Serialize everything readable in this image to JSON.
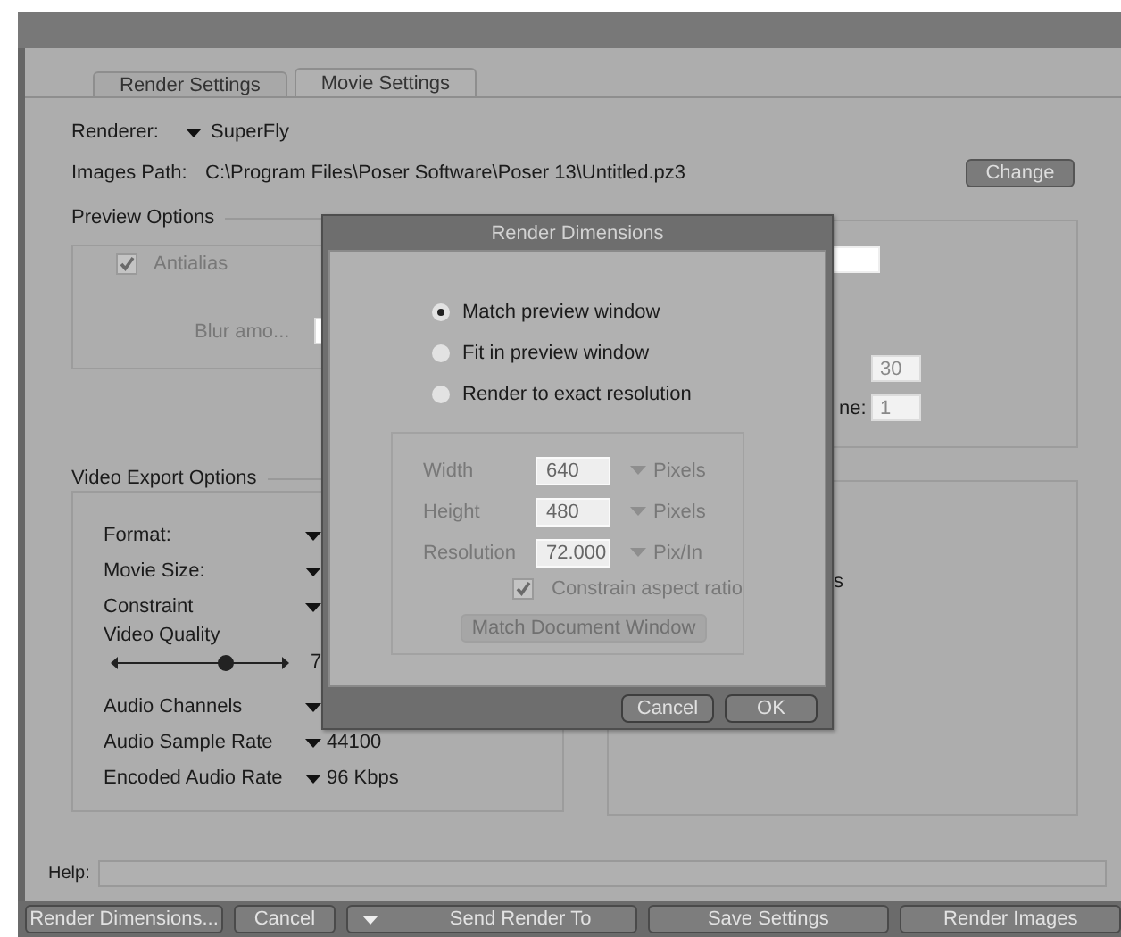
{
  "tabs": [
    {
      "label": "Render Settings",
      "selected": false
    },
    {
      "label": "Movie Settings",
      "selected": true
    }
  ],
  "renderer": {
    "label": "Renderer:",
    "value": "SuperFly"
  },
  "images_path": {
    "label": "Images Path:",
    "value": "C:\\Program Files\\Poser Software\\Poser 13\\Untitled.pz3",
    "button": "Change"
  },
  "preview_options": {
    "title": "Preview Options",
    "antialias": {
      "label": "Antialias",
      "checked": true,
      "disabled": true
    },
    "blur_label": "Blur amo..."
  },
  "right_top_panel": {
    "label_fragment": "ne:",
    "fields": [
      "30",
      "1"
    ]
  },
  "video_export_options": {
    "title": "Video Export Options",
    "rows": [
      {
        "kind": "dropdown",
        "label": "Format:"
      },
      {
        "kind": "dropdown",
        "label": "Movie Size:"
      },
      {
        "kind": "dropdown",
        "label": "Constraint"
      },
      {
        "kind": "slider",
        "label": "Video Quality",
        "level": 0.65,
        "reading": "7"
      },
      {
        "kind": "dropdown",
        "label": "Audio Channels"
      },
      {
        "kind": "dropdown",
        "label": "Audio Sample Rate",
        "value": "44100"
      },
      {
        "kind": "dropdown",
        "label": "Encoded Audio Rate",
        "value": "96 Kbps"
      }
    ]
  },
  "right_bottom_panel": {
    "text_fragment": "s"
  },
  "help": {
    "label": "Help:"
  },
  "bottom_buttons": [
    {
      "label": "Render Dimensions...",
      "kind": "button"
    },
    {
      "label": "Cancel",
      "kind": "button"
    },
    {
      "label": "Send Render To",
      "kind": "menu"
    },
    {
      "label": "Save Settings",
      "kind": "button"
    },
    {
      "label": "Render Images",
      "kind": "button"
    }
  ],
  "dialog": {
    "title": "Render Dimensions",
    "options": [
      {
        "label": "Match preview window",
        "selected": true
      },
      {
        "label": "Fit in preview window",
        "selected": false
      },
      {
        "label": "Render to exact resolution",
        "selected": false
      }
    ],
    "fields": {
      "disabled": true,
      "rows": [
        {
          "label": "Width",
          "value": "640",
          "unit": "Pixels"
        },
        {
          "label": "Height",
          "value": "480",
          "unit": "Pixels"
        },
        {
          "label": "Resolution",
          "value": "72.000",
          "unit": "Pix/In"
        }
      ]
    },
    "constrain": {
      "label": "Constrain aspect ratio",
      "checked": true
    },
    "match_button": "Match Document Window",
    "buttons": [
      "Cancel",
      "OK"
    ]
  }
}
